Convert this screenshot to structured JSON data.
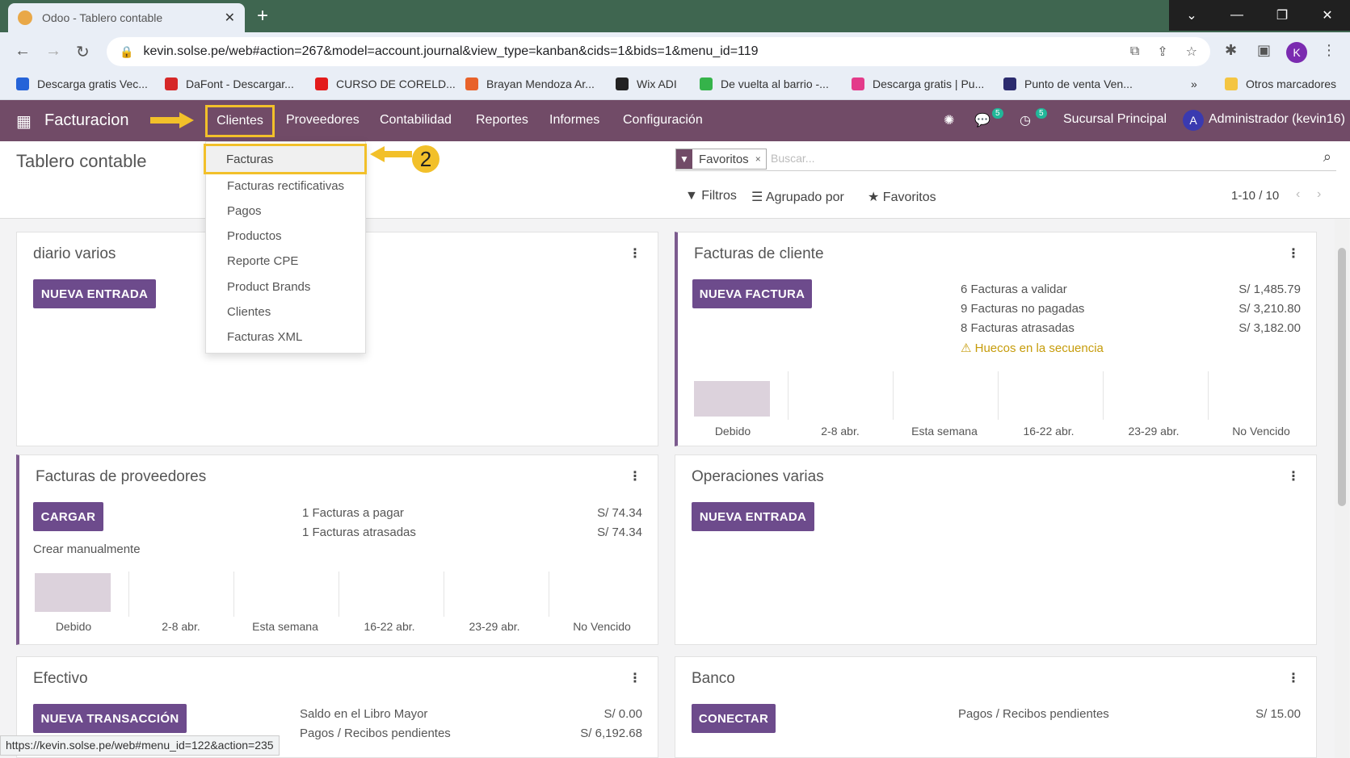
{
  "browser": {
    "tab_title": "Odoo - Tablero contable",
    "url": "kevin.solse.pe/web#action=267&model=account.journal&view_type=kanban&cids=1&bids=1&menu_id=119",
    "profile_initial": "K",
    "bookmarks": [
      {
        "label": "Descarga gratis Vec...",
        "color": "#2563d8"
      },
      {
        "label": "DaFont - Descargar...",
        "color": "#d62828"
      },
      {
        "label": "CURSO DE CORELD...",
        "color": "#e31b1b"
      },
      {
        "label": "Brayan Mendoza Ar...",
        "color": "#e8622a"
      },
      {
        "label": "Wix ADI",
        "color": "#222222"
      },
      {
        "label": "De vuelta al barrio -...",
        "color": "#35b34a"
      },
      {
        "label": "Descarga gratis | Pu...",
        "color": "#e33b8a"
      },
      {
        "label": "Punto de venta Ven...",
        "color": "#2b2b6e"
      }
    ],
    "bookmarks_more": "»",
    "other_bookmarks": "Otros marcadores",
    "status_url": "https://kevin.solse.pe/web#menu_id=122&action=235"
  },
  "navbar": {
    "brand": "Facturacion",
    "menus": [
      "Clientes",
      "Proveedores",
      "Contabilidad",
      "Reportes",
      "Informes",
      "Configuración"
    ],
    "chat_count": "5",
    "activity_count": "5",
    "branch": "Sucursal Principal",
    "user_initial": "A",
    "user": "Administrador (kevin16)"
  },
  "dropdown": {
    "items": [
      "Facturas",
      "Facturas rectificativas",
      "Pagos",
      "Productos",
      "Reporte CPE",
      "Product Brands",
      "Clientes",
      "Facturas XML"
    ],
    "annotation_number": "2"
  },
  "control_panel": {
    "breadcrumb": "Tablero contable",
    "facet": "Favoritos",
    "facet_remove": "×",
    "search_placeholder": "Buscar...",
    "filters": "Filtros",
    "group_by": "Agrupado por",
    "favorites": "Favoritos",
    "pager": "1-10 / 10"
  },
  "graph_labels": [
    "Debido",
    "2-8 abr.",
    "Esta semana",
    "16-22 abr.",
    "23-29 abr.",
    "No Vencido"
  ],
  "cards": {
    "diario": {
      "title": "diario varios",
      "button": "NUEVA ENTRADA"
    },
    "cliente": {
      "title": "Facturas de cliente",
      "button": "NUEVA FACTURA",
      "rows": [
        {
          "label": "6 Facturas a validar",
          "amount": "S/ 1,485.79"
        },
        {
          "label": "9 Facturas no pagadas",
          "amount": "S/ 3,210.80"
        },
        {
          "label": "8 Facturas atrasadas",
          "amount": "S/ 3,182.00"
        }
      ],
      "warning": "Huecos en la secuencia"
    },
    "proveedores": {
      "title": "Facturas de proveedores",
      "button": "CARGAR",
      "link": "Crear manualmente",
      "rows": [
        {
          "label": "1 Facturas a pagar",
          "amount": "S/ 74.34"
        },
        {
          "label": "1 Facturas atrasadas",
          "amount": "S/ 74.34"
        }
      ]
    },
    "operaciones": {
      "title": "Operaciones varias",
      "button": "NUEVA ENTRADA"
    },
    "efectivo": {
      "title": "Efectivo",
      "button": "NUEVA TRANSACCIÓN",
      "rows": [
        {
          "label": "Saldo en el Libro Mayor",
          "amount": "S/ 0.00"
        },
        {
          "label": "Pagos / Recibos pendientes",
          "amount": "S/ 6,192.68"
        }
      ]
    },
    "banco": {
      "title": "Banco",
      "button": "CONECTAR",
      "rows": [
        {
          "label": "Pagos / Recibos pendientes",
          "amount": "S/ 15.00"
        }
      ]
    }
  },
  "colors": {
    "odoo_primary": "#714b67",
    "button": "#6d4b8c",
    "highlight": "#f2c02a",
    "warning": "#c69c0b"
  }
}
